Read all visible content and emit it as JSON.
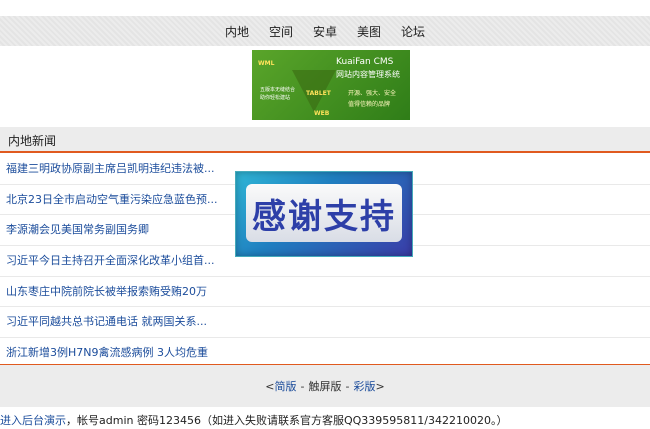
{
  "topnav": [
    "内地",
    "空间",
    "安卓",
    "美图",
    "论坛"
  ],
  "banner": {
    "title": "KuaiFan CMS",
    "subtitle": "网站内容管理系统",
    "tag1": "开源、强大、安全",
    "tag2": "值得信赖的品牌",
    "left1": "五版本无缝结合",
    "left2": "助你轻松建站",
    "wml": "WML",
    "tablet": "TABLET",
    "web": "WEB"
  },
  "section_title": "内地新闻",
  "news": [
    "福建三明政协原副主席吕凯明违纪违法被...",
    "北京23日全市启动空气重污染应急蓝色预...",
    "李源潮会见美国常务副国务卿",
    "习近平今日主持召开全面深化改革小组首...",
    "山东枣庄中院前院长被举报索贿受贿20万",
    "习近平同越共总书记通电话 就两国关系...",
    "浙江新增3例H7N9禽流感病例 3人均危重"
  ],
  "footer": {
    "lt": "<",
    "simple": "简版",
    "touch": "触屏版",
    "color": "彩版",
    "gt": ">"
  },
  "admin": {
    "link": "进入后台演示",
    "text": "，帐号admin 密码123456（如进入失败请联系官方客服QQ339595811/342210020。）"
  },
  "overlay": "感谢支持"
}
